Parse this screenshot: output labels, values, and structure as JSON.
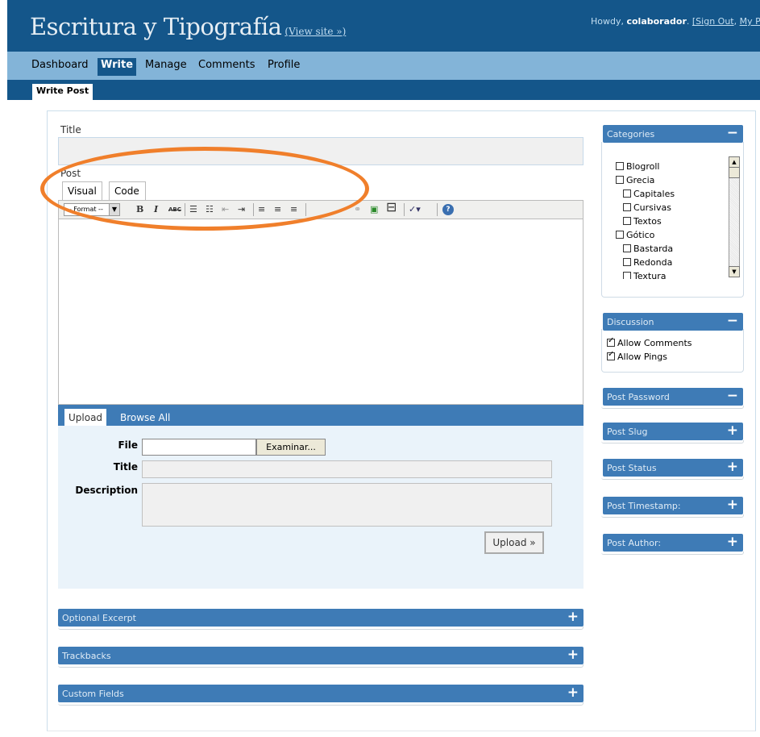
{
  "header": {
    "site_title": "Escritura y Tipografía",
    "view_site": "(View site »)",
    "howdy_prefix": "Howdy, ",
    "username": "colaborador",
    "howdy_sep": ". ",
    "sign_out": "[Sign Out",
    "comma": ", ",
    "my_profile": "My P"
  },
  "menu": {
    "items": [
      {
        "label": "Dashboard"
      },
      {
        "label": "Write"
      },
      {
        "label": "Manage"
      },
      {
        "label": "Comments"
      },
      {
        "label": "Profile"
      }
    ],
    "current": "Write"
  },
  "submenu": {
    "current": "Write Post"
  },
  "post": {
    "title_label": "Title",
    "post_label": "Post",
    "tabs": [
      {
        "label": "Visual"
      },
      {
        "label": "Code"
      }
    ],
    "format_select": "-- Format --",
    "toolbar": {
      "bold": "B",
      "italic": "I",
      "strike": "ABC",
      "bullets": "☰",
      "numbers": "☷",
      "outdent": "⇤",
      "indent": "⇥",
      "align_left": "≡",
      "align_center": "≡",
      "align_right": "≡",
      "unlink": "⚭",
      "image": "▣",
      "more": "⊟",
      "spell": "✓▾",
      "help": "?"
    }
  },
  "upload": {
    "tabs": [
      {
        "label": "Upload"
      },
      {
        "label": "Browse All"
      }
    ],
    "file_label": "File",
    "browse_button": "Examinar...",
    "title_label": "Title",
    "description_label": "Description",
    "upload_button": "Upload »"
  },
  "bottom_boxes": [
    {
      "label": "Optional Excerpt",
      "toggle": "+"
    },
    {
      "label": "Trackbacks",
      "toggle": "+"
    },
    {
      "label": "Custom Fields",
      "toggle": "+"
    }
  ],
  "sidebar": {
    "categories": {
      "label": "Categories",
      "toggle": "−",
      "items": [
        {
          "label": "Blogroll",
          "checked": false
        },
        {
          "label": "Grecia",
          "checked": false
        },
        {
          "label": "Capitales",
          "checked": false
        },
        {
          "label": "Cursivas",
          "checked": false
        },
        {
          "label": "Textos",
          "checked": false
        },
        {
          "label": "Gótico",
          "checked": false
        },
        {
          "label": "Bastarda",
          "checked": false
        },
        {
          "label": "Redonda",
          "checked": false
        },
        {
          "label": "Textura",
          "checked": false
        }
      ]
    },
    "discussion": {
      "label": "Discussion",
      "toggle": "−",
      "items": [
        {
          "label": "Allow Comments",
          "checked": true
        },
        {
          "label": "Allow Pings",
          "checked": true
        }
      ]
    },
    "boxes": [
      {
        "label": "Post Password",
        "toggle": "−"
      },
      {
        "label": "Post Slug",
        "toggle": "+"
      },
      {
        "label": "Post Status",
        "toggle": "+"
      },
      {
        "label": "Post Timestamp:",
        "toggle": "+"
      },
      {
        "label": "Post Author:",
        "toggle": "+"
      }
    ]
  },
  "colors": {
    "header": "#14568a",
    "menu": "#83b4d8",
    "box_bar": "#3e7bb6",
    "annotation": "#f07f2b"
  }
}
